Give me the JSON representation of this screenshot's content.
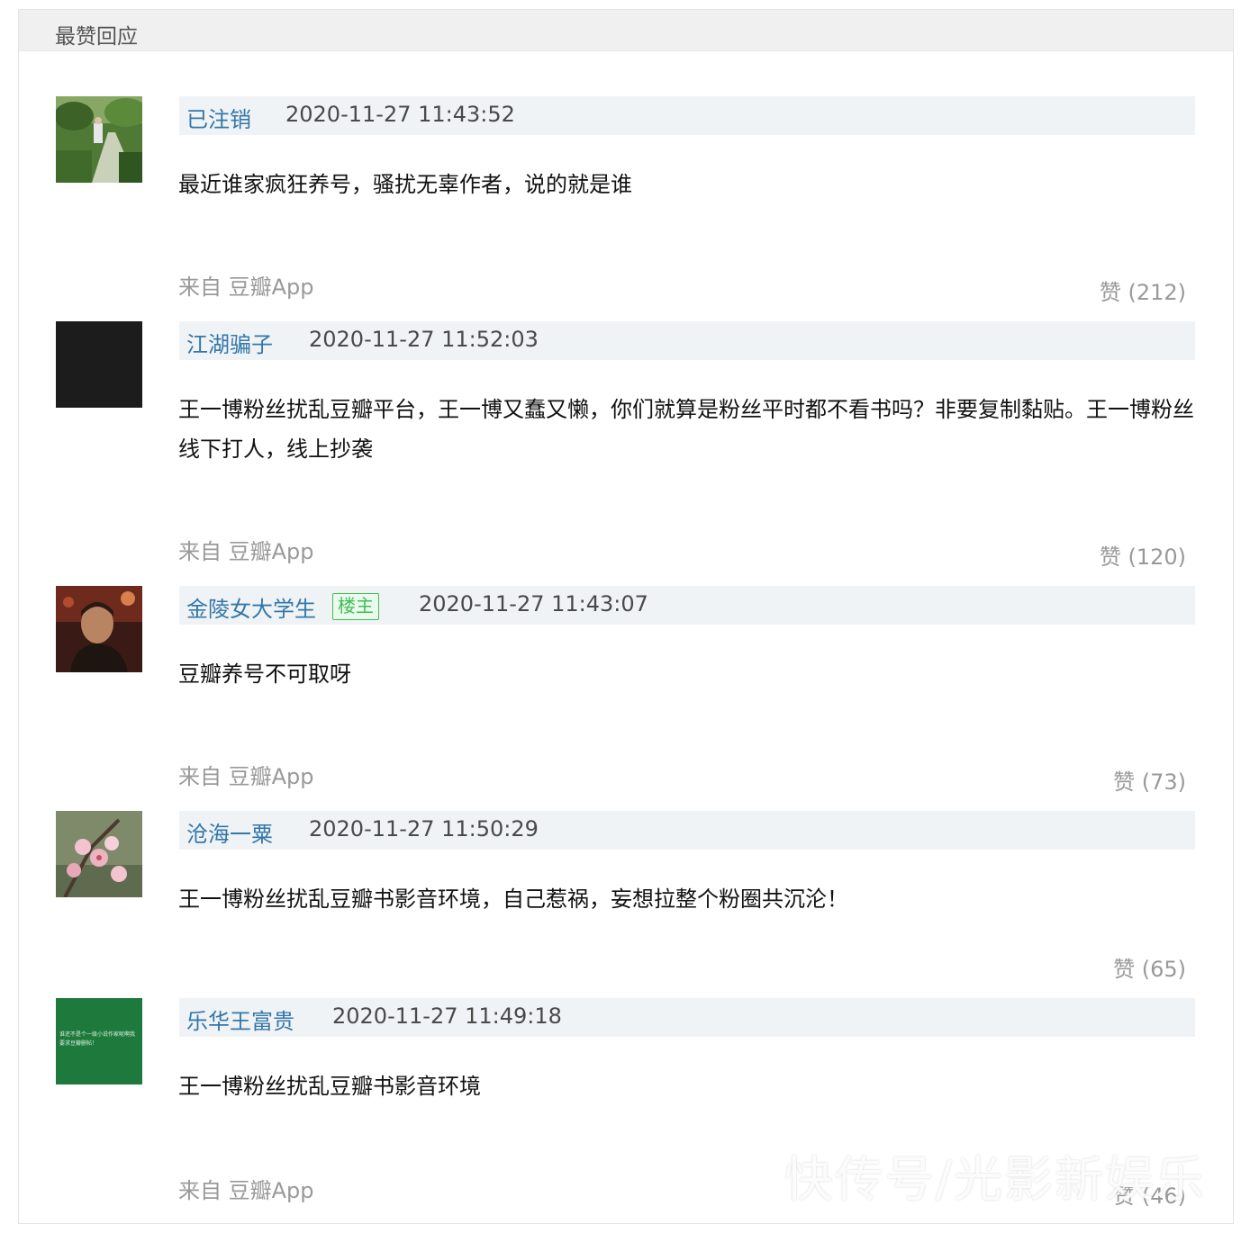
{
  "section": {
    "title": "最赞回应"
  },
  "comments": [
    {
      "author": "已注销",
      "time": "2020-11-27 11:43:52",
      "text": "最近谁家疯狂养号，骚扰无辜作者，说的就是谁",
      "from": "来自 豆瓣App",
      "likes": "赞 (212)"
    },
    {
      "author": "江湖骗子",
      "time": "2020-11-27 11:52:03",
      "text": "王一博粉丝扰乱豆瓣平台，王一博又蠢又懒，你们就算是粉丝平时都不看书吗？非要复制黏贴。王一博粉丝线下打人，线上抄袭",
      "from": "来自 豆瓣App",
      "likes": "赞 (120)"
    },
    {
      "author": "金陵女大学生",
      "badge": "楼主",
      "time": "2020-11-27 11:43:07",
      "text": "豆瓣养号不可取呀",
      "from": "来自 豆瓣App",
      "likes": "赞 (73)"
    },
    {
      "author": "沧海一粟",
      "time": "2020-11-27 11:50:29",
      "text": "王一博粉丝扰乱豆瓣书影音环境，自己惹祸，妄想拉整个粉圈共沉沦！",
      "likes": "赞 (65)"
    },
    {
      "author": "乐华王富贵",
      "time": "2020-11-27 11:49:18",
      "text": "王一博粉丝扰乱豆瓣书影音环境",
      "from": "来自 豆瓣App",
      "likes": "赞 (46)"
    }
  ],
  "avatar_text": "谁还不是个一级小说作家呢啊我要求豆瓣删帖！",
  "watermark": "快传号/光影新娱乐"
}
